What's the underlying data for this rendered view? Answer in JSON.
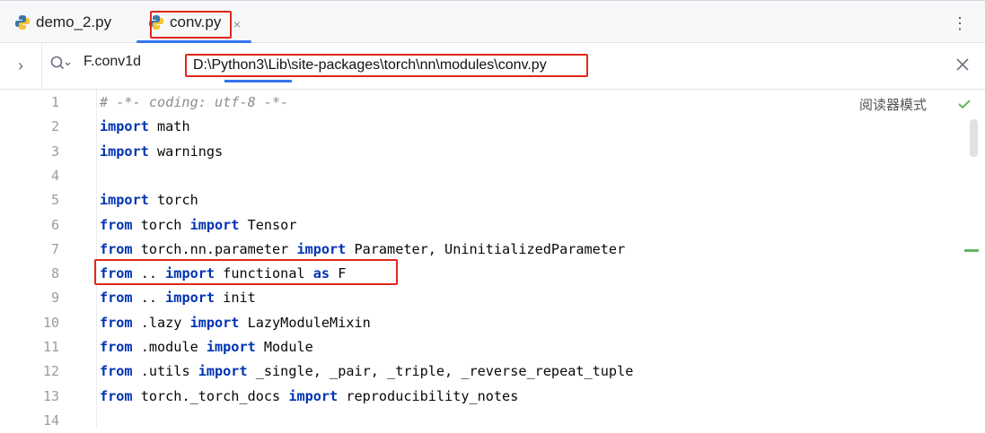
{
  "tabs": [
    {
      "label": "demo_2.py"
    },
    {
      "label": "conv.py"
    }
  ],
  "tab_close_glyph": "×",
  "search": {
    "query": "F.conv1d",
    "path": "D:\\Python3\\Lib\\site-packages\\torch\\nn\\modules\\conv.py"
  },
  "editor": {
    "reader_mode_label": "阅读器模式",
    "lines": [
      {
        "num": "1",
        "text": "# -*- coding: utf-8 -*-"
      },
      {
        "num": "2",
        "text": "import math"
      },
      {
        "num": "3",
        "text": "import warnings"
      },
      {
        "num": "4",
        "text": ""
      },
      {
        "num": "5",
        "text": "import torch"
      },
      {
        "num": "6",
        "text": "from torch import Tensor"
      },
      {
        "num": "7",
        "text": "from torch.nn.parameter import Parameter, UninitializedParameter"
      },
      {
        "num": "8",
        "text": "from .. import functional as F"
      },
      {
        "num": "9",
        "text": "from .. import init"
      },
      {
        "num": "10",
        "text": "from .lazy import LazyModuleMixin"
      },
      {
        "num": "11",
        "text": "from .module import Module"
      },
      {
        "num": "12",
        "text": "from .utils import _single, _pair, _triple, _reverse_repeat_tuple"
      },
      {
        "num": "13",
        "text": "from torch._torch_docs import reproducibility_notes"
      },
      {
        "num": "14",
        "text": ""
      }
    ]
  },
  "colors": {
    "keyword": "#0033b3",
    "comment": "#8c8c8c",
    "highlight_box": "#e0271c",
    "accent": "#3574f0"
  },
  "icons": [
    "python-file-icon",
    "close-icon",
    "more-options-icon",
    "chevron-right-icon",
    "search-icon",
    "check-icon"
  ]
}
